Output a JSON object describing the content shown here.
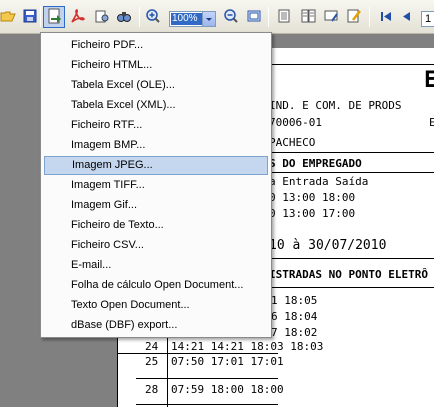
{
  "toolbar": {
    "zoom_value": "100%",
    "page_number": "1",
    "icons": [
      "open-folder-icon",
      "save-icon",
      "export-icon",
      "pdf-icon",
      "print-setup-icon",
      "find-icon",
      "zoom-in-icon",
      "zoom-out-icon",
      "fit-page-icon",
      "single-page-icon",
      "multi-page-icon",
      "edit-page-icon",
      "edit-icon",
      "first-page-icon",
      "previous-page-icon"
    ]
  },
  "export_menu": {
    "items": [
      "Ficheiro PDF...",
      "Ficheiro HTML...",
      "Tabela Excel (OLE)...",
      "Tabela Excel (XML)...",
      "Ficheiro RTF...",
      "Imagem BMP...",
      "Imagem JPEG...",
      "Imagem TIFF...",
      "Imagem Gif...",
      "Ficheiro de Texto...",
      "Ficheiro CSV...",
      "E-mail...",
      "Folha de cálculo Open Document...",
      "Texto Open Document...",
      "dBase (DBF) export..."
    ],
    "highlighted_index": 6,
    "highlight_color": "#c5d7ef"
  },
  "document": {
    "big_char": "E",
    "company": "IND. E COM. DE PRODS",
    "code": "70006-01",
    "right_char": "E",
    "employee": "PACHECO",
    "section_title": "S DO EMPREGADO",
    "schedule_header": "a   Entrada Saída",
    "schedule_rows": [
      "0   13:00   18:00",
      "0   13:00   17:00"
    ],
    "period": "10  à  30/07/2010",
    "records_title": "ISTRADAS NO PONTO ELETRÔ",
    "records": [
      {
        "day": "",
        "times": "1 18:05"
      },
      {
        "day": "",
        "times": "6 18:04"
      },
      {
        "day": "",
        "times": "7 18:02"
      },
      {
        "day": "24",
        "times": "14:21 14:21 18:03 18:03"
      },
      {
        "day": "25",
        "times": "07:50 17:01 17:01"
      },
      {
        "day": "28",
        "times": "07:59 18:00 18:00"
      }
    ]
  }
}
